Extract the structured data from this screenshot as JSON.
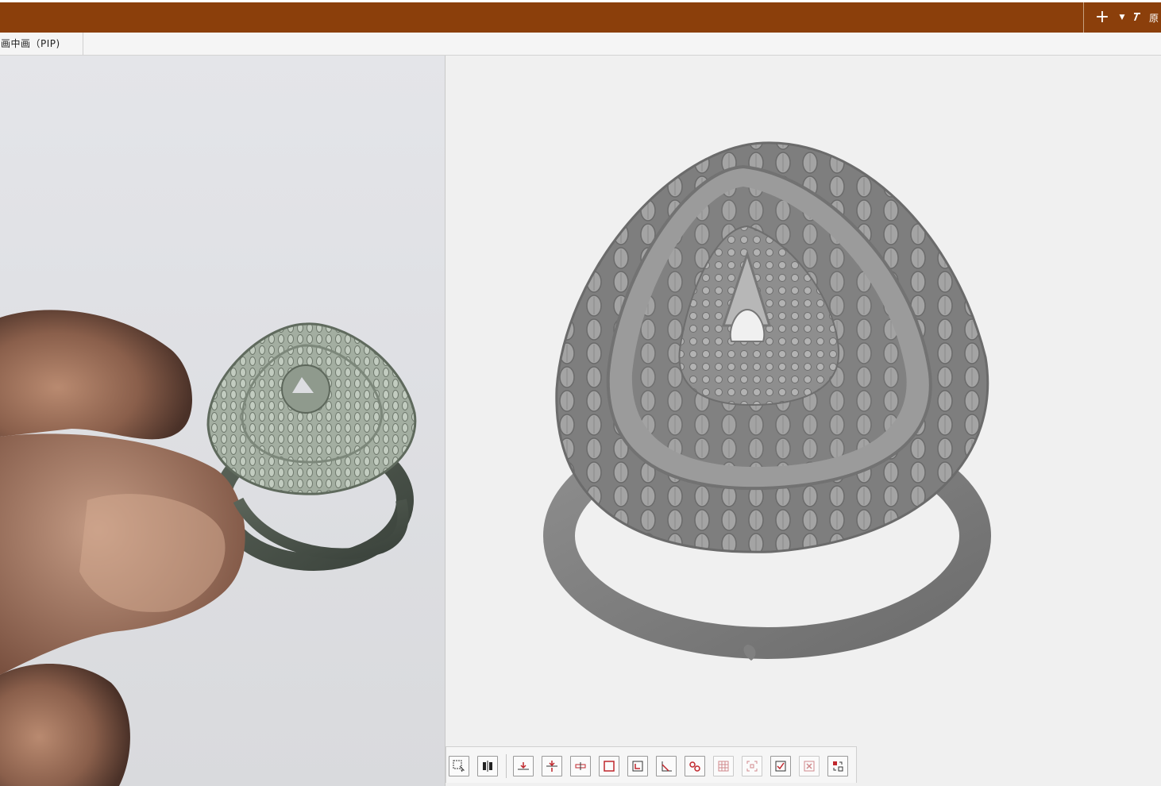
{
  "titlebar": {
    "accent_color": "#8b3f0b",
    "add_icon": "plus-icon",
    "dropdown_icon": "caret-down-icon",
    "pin_icon": "pin-icon",
    "right_label": "原"
  },
  "tabs": [
    {
      "label": "画中画（PIP)"
    }
  ],
  "toolbar": {
    "buttons": [
      {
        "icon": "box-select-icon"
      },
      {
        "icon": "split-view-icon"
      },
      {
        "icon": "align-bottom-icon"
      },
      {
        "icon": "align-center-icon"
      },
      {
        "icon": "distribute-icon"
      },
      {
        "icon": "rectangle-icon"
      },
      {
        "icon": "bound-box-icon"
      },
      {
        "icon": "angle-measure-icon"
      },
      {
        "icon": "connect-icon"
      },
      {
        "icon": "grid-icon"
      },
      {
        "icon": "fit-view-icon"
      },
      {
        "icon": "check-icon"
      },
      {
        "icon": "delete-icon"
      },
      {
        "icon": "swap-icon"
      }
    ]
  }
}
